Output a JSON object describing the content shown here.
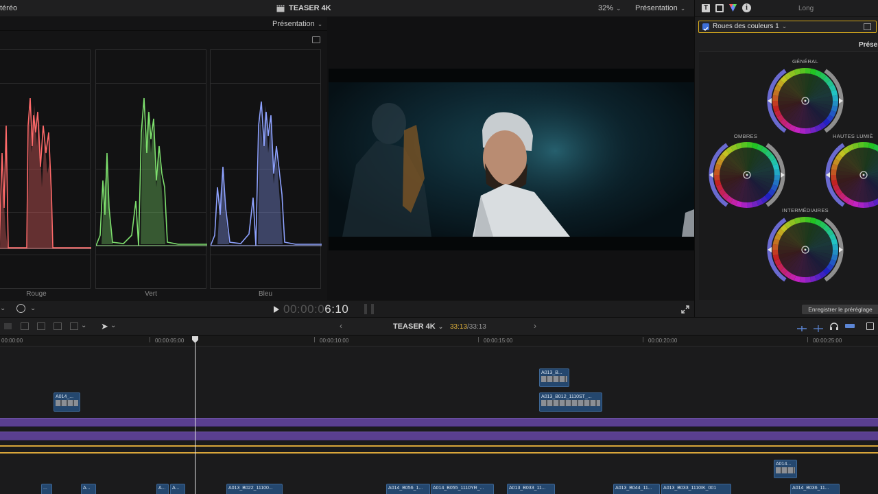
{
  "topbar": {
    "left_menu": "téréo",
    "project_title": "TEASER 4K",
    "zoom": "32%",
    "view_menu": "Présentation"
  },
  "scopes": {
    "view_menu": "Présentation",
    "channels": [
      "Rouge",
      "Vert",
      "Bleu"
    ],
    "colors": {
      "red": "#ff6a6a",
      "green": "#7ee06e",
      "blue": "#8ea2ff"
    }
  },
  "inspector": {
    "tabs": [
      "T",
      "film-icon",
      "color-icon",
      "i"
    ],
    "duration_label": "Long",
    "effect_name": "Roues des couleurs 1",
    "presentation_label": "Présen",
    "wheels": [
      "GÉNÉRAL",
      "OMBRES",
      "HAUTES LUMIÈ",
      "INTERMÉDIAIRES"
    ],
    "save_preset": "Enregistrer le préréglage"
  },
  "transport": {
    "timecode_dim": "00:00:0",
    "timecode_bright": "6:10"
  },
  "timeline": {
    "project_name": "TEASER 4K",
    "duration_current": "33:13",
    "duration_total": "/33:13",
    "ruler": [
      "00:00:00",
      "00:00:05:00",
      "00:00:10:00",
      "00:00:15:00",
      "00:00:20:00",
      "00:00:25:00"
    ],
    "clips_upper": [
      {
        "name": "A013_B..."
      },
      {
        "name": "A014_..."
      },
      {
        "name": "A013_B012_1110ST_..."
      },
      {
        "name": "A014..."
      }
    ],
    "clips_lower": [
      {
        "name": "..."
      },
      {
        "name": "A..."
      },
      {
        "name": "A..."
      },
      {
        "name": "A..."
      },
      {
        "name": "A013_B022_11100..."
      },
      {
        "name": "A014_B056_1..."
      },
      {
        "name": "A014_B055_1110YR_..."
      },
      {
        "name": "A013_B033_11..."
      },
      {
        "name": "A013_B044_11..."
      },
      {
        "name": "A013_B033_1110IK_001"
      },
      {
        "name": "A014_B036_11..."
      }
    ]
  }
}
